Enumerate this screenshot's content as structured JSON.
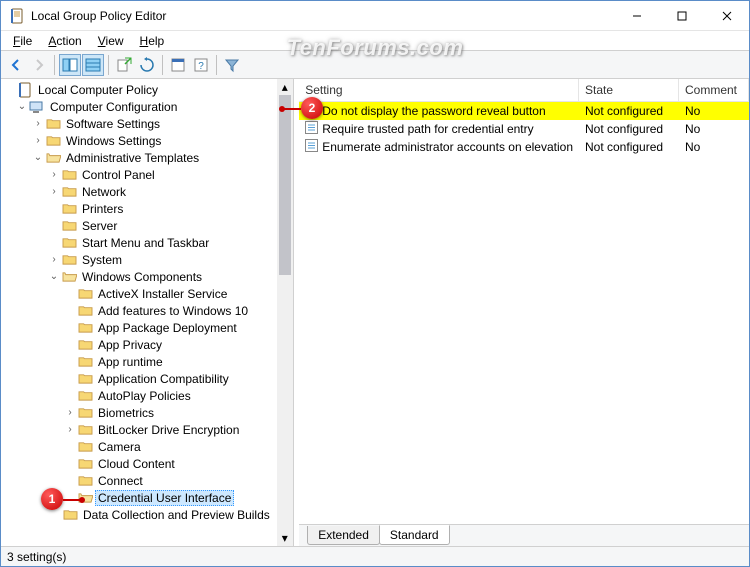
{
  "window": {
    "title": "Local Group Policy Editor"
  },
  "menubar": {
    "file": "File",
    "action": "Action",
    "view": "View",
    "help": "Help"
  },
  "tree": {
    "root": "Local Computer Policy",
    "computer_config": "Computer Configuration",
    "software_settings": "Software Settings",
    "windows_settings": "Windows Settings",
    "admin_templates": "Administrative Templates",
    "control_panel": "Control Panel",
    "network": "Network",
    "printers": "Printers",
    "server": "Server",
    "start_menu": "Start Menu and Taskbar",
    "system": "System",
    "windows_components": "Windows Components",
    "wc": {
      "activex": "ActiveX Installer Service",
      "add_features": "Add features to Windows 10",
      "app_package": "App Package Deployment",
      "app_privacy": "App Privacy",
      "app_runtime": "App runtime",
      "app_compat": "Application Compatibility",
      "autoplay": "AutoPlay Policies",
      "biometrics": "Biometrics",
      "bitlocker": "BitLocker Drive Encryption",
      "camera": "Camera",
      "cloud": "Cloud Content",
      "connect": "Connect",
      "cred_ui": "Credential User Interface",
      "data_coll": "Data Collection and Preview Builds"
    }
  },
  "columns": {
    "setting": "Setting",
    "state": "State",
    "comment": "Comment"
  },
  "settings": [
    {
      "name": "Do not display the password reveal button",
      "state": "Not configured",
      "comment": "No",
      "highlight": true
    },
    {
      "name": "Require trusted path for credential entry",
      "state": "Not configured",
      "comment": "No",
      "highlight": false
    },
    {
      "name": "Enumerate administrator accounts on elevation",
      "state": "Not configured",
      "comment": "No",
      "highlight": false
    }
  ],
  "tabs": {
    "extended": "Extended",
    "standard": "Standard"
  },
  "statusbar": {
    "text": "3 setting(s)"
  },
  "watermark": "TenForums.com",
  "callouts": {
    "one": "1",
    "two": "2"
  }
}
